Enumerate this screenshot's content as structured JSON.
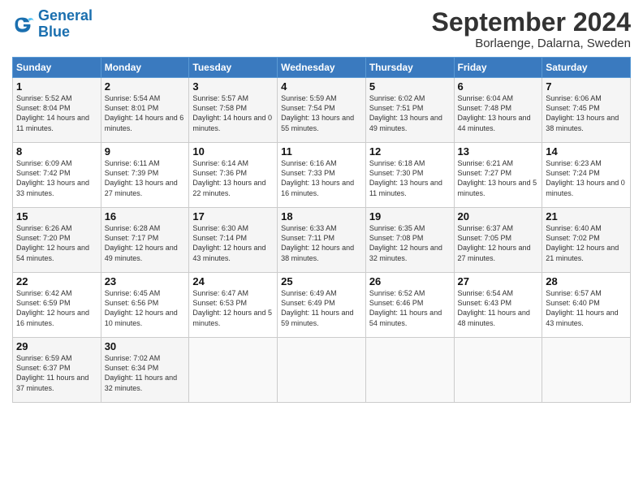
{
  "header": {
    "logo_line1": "General",
    "logo_line2": "Blue",
    "month": "September 2024",
    "location": "Borlaenge, Dalarna, Sweden"
  },
  "days_of_week": [
    "Sunday",
    "Monday",
    "Tuesday",
    "Wednesday",
    "Thursday",
    "Friday",
    "Saturday"
  ],
  "weeks": [
    [
      {
        "day": "1",
        "sunrise": "5:52 AM",
        "sunset": "8:04 PM",
        "daylight": "14 hours and 11 minutes."
      },
      {
        "day": "2",
        "sunrise": "5:54 AM",
        "sunset": "8:01 PM",
        "daylight": "14 hours and 6 minutes."
      },
      {
        "day": "3",
        "sunrise": "5:57 AM",
        "sunset": "7:58 PM",
        "daylight": "14 hours and 0 minutes."
      },
      {
        "day": "4",
        "sunrise": "5:59 AM",
        "sunset": "7:54 PM",
        "daylight": "13 hours and 55 minutes."
      },
      {
        "day": "5",
        "sunrise": "6:02 AM",
        "sunset": "7:51 PM",
        "daylight": "13 hours and 49 minutes."
      },
      {
        "day": "6",
        "sunrise": "6:04 AM",
        "sunset": "7:48 PM",
        "daylight": "13 hours and 44 minutes."
      },
      {
        "day": "7",
        "sunrise": "6:06 AM",
        "sunset": "7:45 PM",
        "daylight": "13 hours and 38 minutes."
      }
    ],
    [
      {
        "day": "8",
        "sunrise": "6:09 AM",
        "sunset": "7:42 PM",
        "daylight": "13 hours and 33 minutes."
      },
      {
        "day": "9",
        "sunrise": "6:11 AM",
        "sunset": "7:39 PM",
        "daylight": "13 hours and 27 minutes."
      },
      {
        "day": "10",
        "sunrise": "6:14 AM",
        "sunset": "7:36 PM",
        "daylight": "13 hours and 22 minutes."
      },
      {
        "day": "11",
        "sunrise": "6:16 AM",
        "sunset": "7:33 PM",
        "daylight": "13 hours and 16 minutes."
      },
      {
        "day": "12",
        "sunrise": "6:18 AM",
        "sunset": "7:30 PM",
        "daylight": "13 hours and 11 minutes."
      },
      {
        "day": "13",
        "sunrise": "6:21 AM",
        "sunset": "7:27 PM",
        "daylight": "13 hours and 5 minutes."
      },
      {
        "day": "14",
        "sunrise": "6:23 AM",
        "sunset": "7:24 PM",
        "daylight": "13 hours and 0 minutes."
      }
    ],
    [
      {
        "day": "15",
        "sunrise": "6:26 AM",
        "sunset": "7:20 PM",
        "daylight": "12 hours and 54 minutes."
      },
      {
        "day": "16",
        "sunrise": "6:28 AM",
        "sunset": "7:17 PM",
        "daylight": "12 hours and 49 minutes."
      },
      {
        "day": "17",
        "sunrise": "6:30 AM",
        "sunset": "7:14 PM",
        "daylight": "12 hours and 43 minutes."
      },
      {
        "day": "18",
        "sunrise": "6:33 AM",
        "sunset": "7:11 PM",
        "daylight": "12 hours and 38 minutes."
      },
      {
        "day": "19",
        "sunrise": "6:35 AM",
        "sunset": "7:08 PM",
        "daylight": "12 hours and 32 minutes."
      },
      {
        "day": "20",
        "sunrise": "6:37 AM",
        "sunset": "7:05 PM",
        "daylight": "12 hours and 27 minutes."
      },
      {
        "day": "21",
        "sunrise": "6:40 AM",
        "sunset": "7:02 PM",
        "daylight": "12 hours and 21 minutes."
      }
    ],
    [
      {
        "day": "22",
        "sunrise": "6:42 AM",
        "sunset": "6:59 PM",
        "daylight": "12 hours and 16 minutes."
      },
      {
        "day": "23",
        "sunrise": "6:45 AM",
        "sunset": "6:56 PM",
        "daylight": "12 hours and 10 minutes."
      },
      {
        "day": "24",
        "sunrise": "6:47 AM",
        "sunset": "6:53 PM",
        "daylight": "12 hours and 5 minutes."
      },
      {
        "day": "25",
        "sunrise": "6:49 AM",
        "sunset": "6:49 PM",
        "daylight": "11 hours and 59 minutes."
      },
      {
        "day": "26",
        "sunrise": "6:52 AM",
        "sunset": "6:46 PM",
        "daylight": "11 hours and 54 minutes."
      },
      {
        "day": "27",
        "sunrise": "6:54 AM",
        "sunset": "6:43 PM",
        "daylight": "11 hours and 48 minutes."
      },
      {
        "day": "28",
        "sunrise": "6:57 AM",
        "sunset": "6:40 PM",
        "daylight": "11 hours and 43 minutes."
      }
    ],
    [
      {
        "day": "29",
        "sunrise": "6:59 AM",
        "sunset": "6:37 PM",
        "daylight": "11 hours and 37 minutes."
      },
      {
        "day": "30",
        "sunrise": "7:02 AM",
        "sunset": "6:34 PM",
        "daylight": "11 hours and 32 minutes."
      },
      {
        "day": "",
        "sunrise": "",
        "sunset": "",
        "daylight": ""
      },
      {
        "day": "",
        "sunrise": "",
        "sunset": "",
        "daylight": ""
      },
      {
        "day": "",
        "sunrise": "",
        "sunset": "",
        "daylight": ""
      },
      {
        "day": "",
        "sunrise": "",
        "sunset": "",
        "daylight": ""
      },
      {
        "day": "",
        "sunrise": "",
        "sunset": "",
        "daylight": ""
      }
    ]
  ]
}
